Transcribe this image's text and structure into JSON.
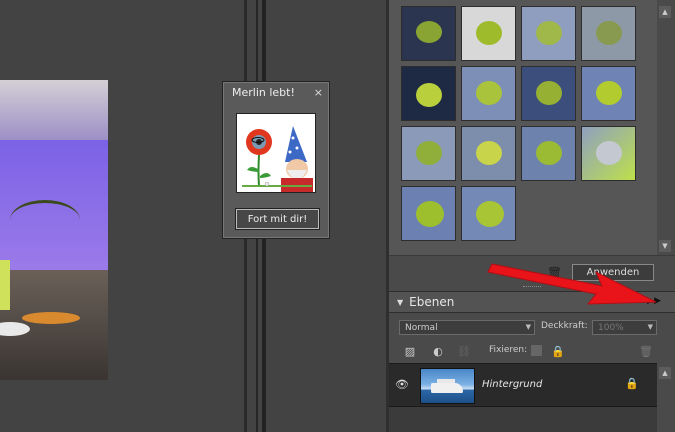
{
  "dialog": {
    "title": "Merlin lebt!",
    "close_glyph": "×",
    "button_label": "Fort mit dir!"
  },
  "filters_panel": {
    "apply_label": "Anwenden",
    "scroll_up_glyph": "▲",
    "scroll_down_glyph": "▼",
    "trash_glyph": "🗑"
  },
  "layers_panel": {
    "header_triangle": "▼",
    "title": "Ebenen",
    "menu_glyph": "▶▶",
    "blend_mode": "Normal",
    "dropdown_glyph": "▼",
    "opacity_label": "Deckkraft:",
    "opacity_value": "100%",
    "fix_label": "Fixieren:",
    "tool_new_layer": "▨",
    "tool_adjust": "◐",
    "tool_link": "⛓",
    "tool_delete": "🗑",
    "layer": {
      "visibility_glyph": "👁",
      "name": "Hintergrund",
      "lock_glyph": "🔒"
    },
    "scroll_up_glyph": "▲"
  },
  "colors": {
    "annotation_arrow": "#e8141a",
    "apple_green": "#9dbb2b"
  }
}
